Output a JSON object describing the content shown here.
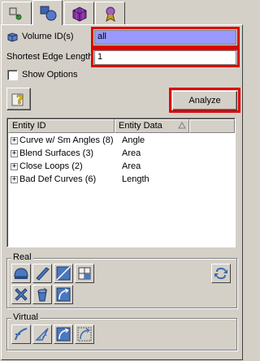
{
  "tabs": [
    {
      "icon": "geometry-vertex-icon"
    },
    {
      "icon": "volume-shapes-icon",
      "active": true
    },
    {
      "icon": "mesh-cube-icon"
    },
    {
      "icon": "quality-ribbon-icon"
    }
  ],
  "form": {
    "volume_label": "Volume ID(s)",
    "volume_value": "all",
    "edge_label": "Shortest Edge Length",
    "edge_value": "1",
    "show_options_label": "Show Options",
    "analyze_label": "Analyze"
  },
  "table": {
    "columns": [
      "Entity ID",
      "Entity Data"
    ],
    "rows": [
      {
        "name": "Curve w/ Sm Angles (8)",
        "data": "Angle"
      },
      {
        "name": "Blend Surfaces (3)",
        "data": "Area"
      },
      {
        "name": "Close Loops (2)",
        "data": "Area"
      },
      {
        "name": "Bad Def Curves (6)",
        "data": "Length"
      }
    ]
  },
  "groups": {
    "real_label": "Real",
    "virtual_label": "Virtual"
  },
  "colors": {
    "highlight": "#e00000",
    "volume_field_bg": "#9999ff",
    "panel_bg": "#d4d0c8"
  }
}
